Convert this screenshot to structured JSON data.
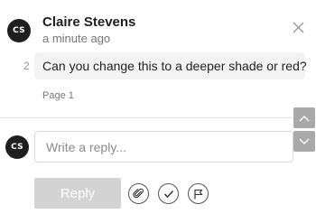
{
  "comment": {
    "author_initials": "CS",
    "author_name": "Claire Stevens",
    "timestamp": "a minute ago",
    "number": "2",
    "text": "Can you change this to a deeper shade or red?",
    "page_label": "Page 1"
  },
  "reply": {
    "avatar_initials": "CS",
    "placeholder": "Write a reply...",
    "submit_label": "Reply"
  },
  "icons": {
    "close": "close-icon",
    "scroll_up": "chevron-up-icon",
    "scroll_down": "chevron-down-icon",
    "attach": "paperclip-icon",
    "resolve": "checkmark-icon",
    "flag": "flag-icon"
  },
  "colors": {
    "avatar_bg": "#1f1f1f",
    "bubble_bg": "#f3f3f3",
    "reply_button_bg": "#d3d3d3",
    "scroll_button_bg": "#a9a9a9"
  }
}
